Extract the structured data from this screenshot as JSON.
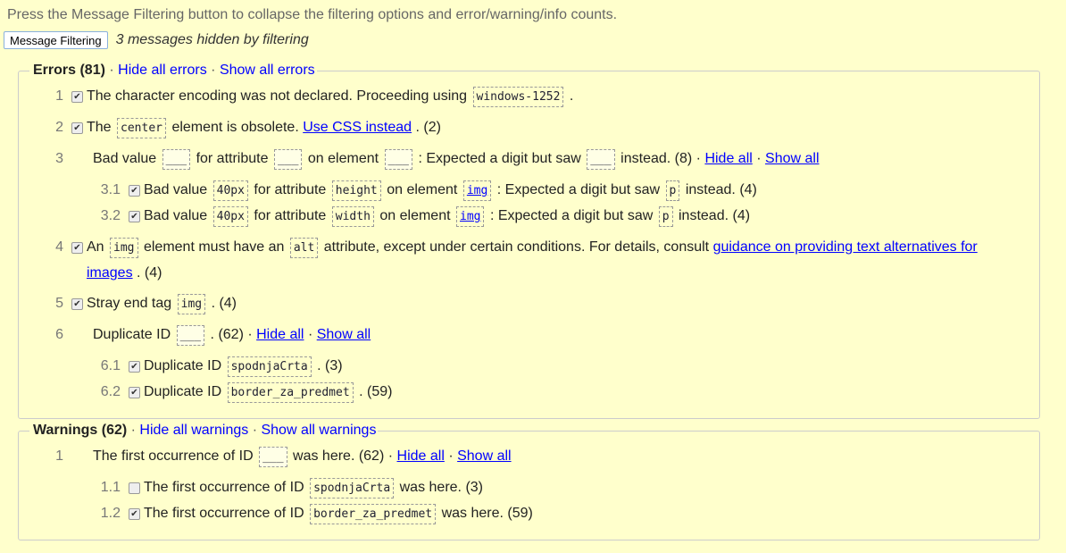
{
  "intro": "Press the Message Filtering button to collapse the filtering options and error/warning/info counts.",
  "filter_button": "Message Filtering",
  "hidden_count": "3 messages hidden by filtering",
  "colors": {
    "background": "#ffffcc",
    "link": "#0000ff"
  },
  "groups": [
    {
      "id": "errors",
      "title": "Errors (81)",
      "hide_all": "Hide all errors",
      "show_all": "Show all errors",
      "items": [
        {
          "num": "1",
          "checked": true,
          "segments": [
            {
              "t": "The character encoding was not declared. Proceeding using"
            },
            {
              "c": "windows-1252"
            },
            {
              "t": "."
            }
          ]
        },
        {
          "num": "2",
          "checked": true,
          "segments": [
            {
              "t": "The"
            },
            {
              "c": "center"
            },
            {
              "t": "element is obsolete."
            },
            {
              "l": "Use CSS instead"
            },
            {
              "t": ". (2)"
            }
          ]
        },
        {
          "num": "3",
          "segments": [
            {
              "t": "Bad value"
            },
            {
              "p": "___"
            },
            {
              "t": "for attribute"
            },
            {
              "p": "___"
            },
            {
              "t": "on element"
            },
            {
              "p": "___"
            },
            {
              "t": ": Expected a digit but saw"
            },
            {
              "p": "___"
            },
            {
              "t": "instead. (8) ·"
            },
            {
              "l": "Hide all"
            },
            {
              "t": "·"
            },
            {
              "l": "Show all"
            }
          ],
          "children": [
            {
              "num": "3.1",
              "checked": true,
              "segments": [
                {
                  "t": "Bad value"
                },
                {
                  "c": "40px"
                },
                {
                  "t": "for attribute"
                },
                {
                  "c": "height"
                },
                {
                  "t": "on element"
                },
                {
                  "cl": "img"
                },
                {
                  "t": ": Expected a digit but saw"
                },
                {
                  "c": "p"
                },
                {
                  "t": "instead. (4)"
                }
              ]
            },
            {
              "num": "3.2",
              "checked": true,
              "segments": [
                {
                  "t": "Bad value"
                },
                {
                  "c": "40px"
                },
                {
                  "t": "for attribute"
                },
                {
                  "c": "width"
                },
                {
                  "t": "on element"
                },
                {
                  "cl": "img"
                },
                {
                  "t": ": Expected a digit but saw"
                },
                {
                  "c": "p"
                },
                {
                  "t": "instead. (4)"
                }
              ]
            }
          ]
        },
        {
          "num": "4",
          "checked": true,
          "segments": [
            {
              "t": "An"
            },
            {
              "c": "img"
            },
            {
              "t": "element must have an"
            },
            {
              "c": "alt"
            },
            {
              "t": "attribute, except under certain conditions. For details, consult"
            },
            {
              "l": "guidance on providing text alternatives for images"
            },
            {
              "t": ". (4)"
            }
          ]
        },
        {
          "num": "5",
          "checked": true,
          "segments": [
            {
              "t": "Stray end tag"
            },
            {
              "c": "img"
            },
            {
              "t": ". (4)"
            }
          ]
        },
        {
          "num": "6",
          "segments": [
            {
              "t": "Duplicate ID"
            },
            {
              "p": "___"
            },
            {
              "t": ". (62) ·"
            },
            {
              "l": "Hide all"
            },
            {
              "t": "·"
            },
            {
              "l": "Show all"
            }
          ],
          "children": [
            {
              "num": "6.1",
              "checked": true,
              "segments": [
                {
                  "t": "Duplicate ID"
                },
                {
                  "c": "spodnjaCrta"
                },
                {
                  "t": ". (3)"
                }
              ]
            },
            {
              "num": "6.2",
              "checked": true,
              "segments": [
                {
                  "t": "Duplicate ID"
                },
                {
                  "c": "border_za_predmet"
                },
                {
                  "t": ". (59)"
                }
              ]
            }
          ]
        }
      ]
    },
    {
      "id": "warnings",
      "title": "Warnings (62)",
      "hide_all": "Hide all warnings",
      "show_all": "Show all warnings",
      "items": [
        {
          "num": "1",
          "segments": [
            {
              "t": "The first occurrence of ID"
            },
            {
              "p": "___"
            },
            {
              "t": "was here. (62) ·"
            },
            {
              "l": "Hide all"
            },
            {
              "t": "·"
            },
            {
              "l": "Show all"
            }
          ],
          "children": [
            {
              "num": "1.1",
              "checked": false,
              "segments": [
                {
                  "t": "The first occurrence of ID"
                },
                {
                  "c": "spodnjaCrta"
                },
                {
                  "t": "was here. (3)"
                }
              ]
            },
            {
              "num": "1.2",
              "checked": true,
              "segments": [
                {
                  "t": "The first occurrence of ID"
                },
                {
                  "c": "border_za_predmet"
                },
                {
                  "t": "was here. (59)"
                }
              ]
            }
          ]
        }
      ]
    }
  ]
}
